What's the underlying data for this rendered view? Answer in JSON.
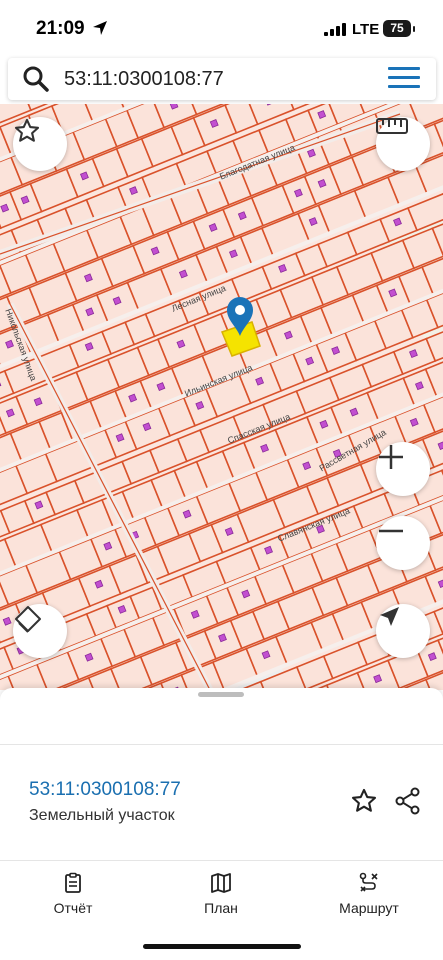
{
  "status_bar": {
    "time": "21:09",
    "network": "LTE",
    "battery": "75"
  },
  "search": {
    "value": "53:11:0300108:77",
    "placeholder": ""
  },
  "map": {
    "streets": [
      "Благодатная улица",
      "Лесная улица",
      "Ильинская улица",
      "Спасская улица",
      "Рассветная улица",
      "Славянская улица",
      "Никольская улица"
    ],
    "selected_parcel_color": "#f5e300",
    "parcel_border_color": "#d9522b",
    "marker_color": "#1a73b8"
  },
  "parcel": {
    "cadastral_number": "53:11:0300108:77",
    "type": "Земельный участок"
  },
  "tabs": [
    {
      "label": "Отчёт",
      "icon": "report-icon"
    },
    {
      "label": "План",
      "icon": "map-icon"
    },
    {
      "label": "Маршрут",
      "icon": "route-icon"
    }
  ]
}
